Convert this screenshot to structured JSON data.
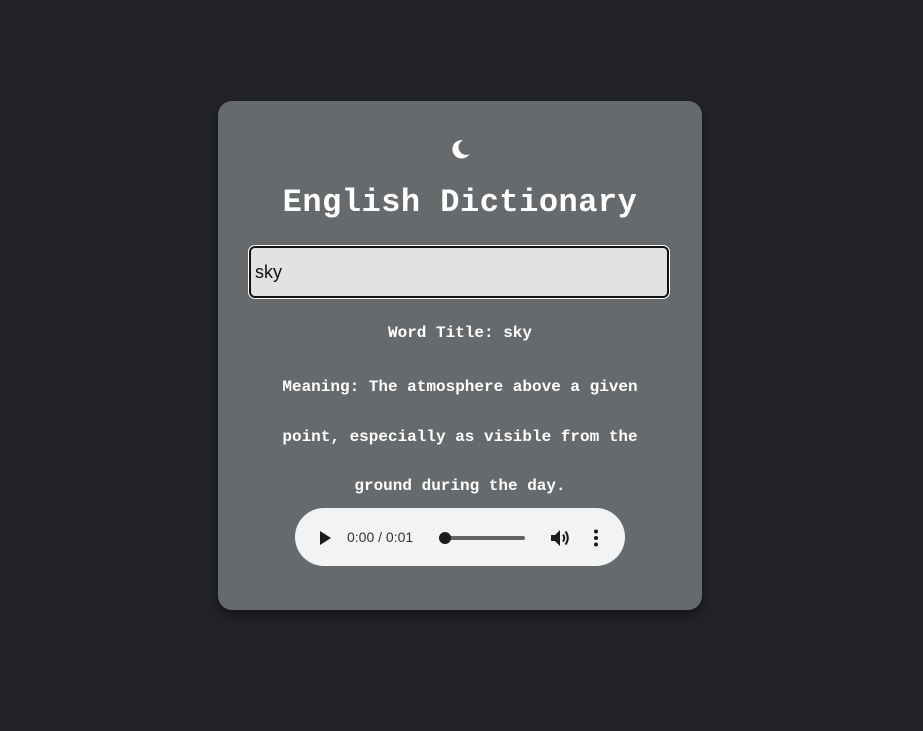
{
  "header": {
    "theme_icon": "moon-icon",
    "title": "English Dictionary"
  },
  "search": {
    "value": "sky",
    "placeholder": ""
  },
  "result": {
    "word_title": "Word Title: sky",
    "meaning_lines": [
      "Meaning: The atmosphere above a given",
      "point, especially as visible from the",
      "ground during the day."
    ]
  },
  "audio_player": {
    "time_display": "0:00 / 0:01",
    "progress": 0,
    "icons": [
      "play-icon",
      "volume-icon",
      "more-options-icon"
    ]
  },
  "colors": {
    "background": "#222428",
    "card": "#676a6c",
    "text": "#ffffff",
    "input_background": "#e1e3e1",
    "player_background": "#f1f3f4"
  }
}
